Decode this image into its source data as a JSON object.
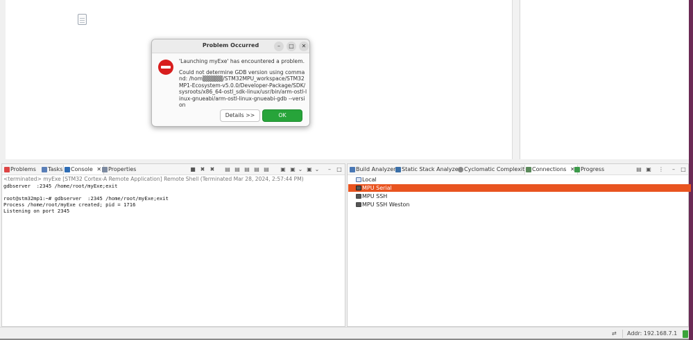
{
  "dialog": {
    "title": "Problem Occurred",
    "message": "'Launching myExe' has encountered a problem.",
    "detail": "Could not determine GDB version using command: /hom▒▒▒▒▒/STM32MPU_workspace/STM32MP1-Ecosystem-v5.0.0/Developer-Package/SDK/sysroots/x86_64-ostl_sdk-linux/usr/bin/arm-ostl-linux-gnueabi/arm-ostl-linux-gnueabi-gdb --version",
    "details_label": "Details >>",
    "ok_label": "OK",
    "minimize_glyph": "–",
    "maximize_glyph": "□",
    "close_glyph": "✕"
  },
  "console_tabs": [
    {
      "label": "Problems"
    },
    {
      "label": "Tasks"
    },
    {
      "label": "Console"
    },
    {
      "label": "Properties"
    }
  ],
  "console": {
    "header": "<terminated> myExe [STM32 Cortex-A Remote Application] Remote Shell (Terminated Mar 28, 2024, 2:57:44 PM)",
    "output": "gdbserver  :2345 /home/root/myExe;exit\n\nroot@stm32mp1:~# gdbserver  :2345 /home/root/myExe;exit\nProcess /home/root/myExe created; pid = 1716\nListening on port 2345"
  },
  "right_tabs": [
    {
      "label": "Build Analyzer"
    },
    {
      "label": "Static Stack Analyzer"
    },
    {
      "label": "Cyclomatic Complexity"
    },
    {
      "label": "Connections"
    },
    {
      "label": "Progress"
    }
  ],
  "connections": [
    {
      "label": "Local",
      "selected": false
    },
    {
      "label": "MPU Serial",
      "selected": true
    },
    {
      "label": "MPU SSH",
      "selected": false
    },
    {
      "label": "MPU SSH Weston",
      "selected": false
    }
  ],
  "statusbar": {
    "addr": "Addr: 192.168.7.1"
  },
  "colors": {
    "selection": "#e95420",
    "ok_button": "#27a43a",
    "error_icon": "#d81e1e"
  }
}
